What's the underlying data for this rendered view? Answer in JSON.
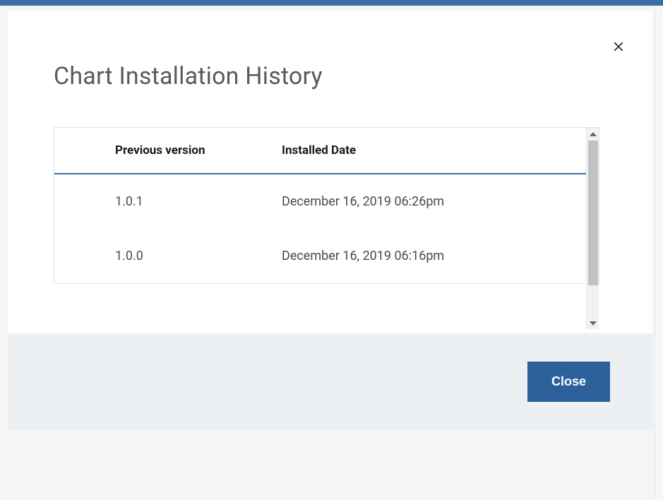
{
  "modal": {
    "title": "Chart Installation History",
    "close_label": "Close"
  },
  "table": {
    "headers": {
      "version": "Previous version",
      "date": "Installed Date"
    },
    "rows": [
      {
        "version": "1.0.1",
        "date": "December 16, 2019 06:26pm"
      },
      {
        "version": "1.0.0",
        "date": "December 16, 2019 06:16pm"
      }
    ]
  }
}
